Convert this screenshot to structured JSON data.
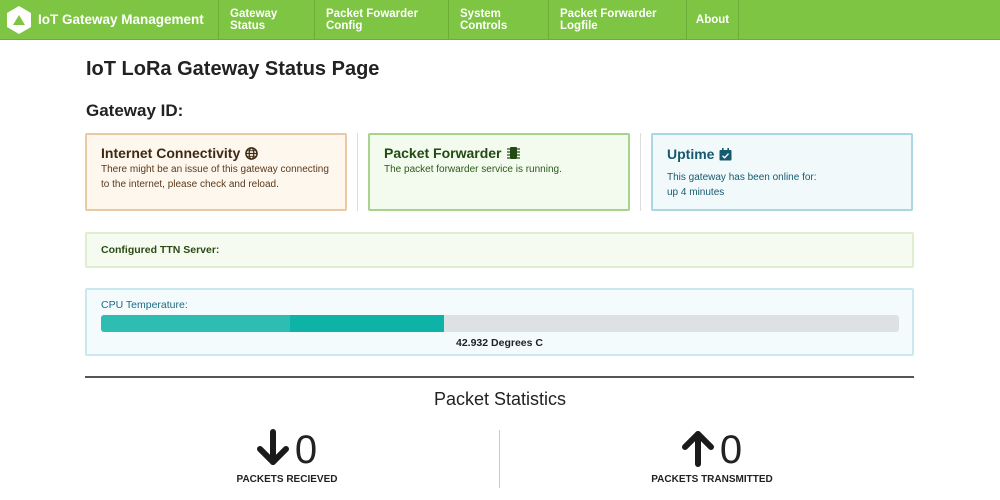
{
  "navbar": {
    "brand": "IoT Gateway Management",
    "items": [
      {
        "label": "Gateway Status"
      },
      {
        "label": "Packet Fowarder Config"
      },
      {
        "label": "System Controls"
      },
      {
        "label": "Packet Forwarder Logfile"
      },
      {
        "label": "About"
      }
    ]
  },
  "page": {
    "title": "IoT LoRa Gateway Status Page",
    "gateway_id_label": "Gateway ID:",
    "gateway_id_value": ""
  },
  "cards": {
    "internet": {
      "title": "Internet Connectivity",
      "icon": "globe-icon",
      "body": "There might be an issue of this gateway connecting to the internet, please check and reload."
    },
    "packet_forwarder": {
      "title": "Packet Forwarder",
      "icon": "chip-icon",
      "body": "The packet forwarder service is running."
    },
    "uptime": {
      "title": "Uptime",
      "icon": "calendar-check-icon",
      "body_line1": "This gateway has been online for:",
      "body_line2": "up 4 minutes"
    }
  },
  "ttn": {
    "label": "Configured TTN Server:",
    "value": ""
  },
  "cpu": {
    "label": "CPU Temperature:",
    "value_text": "42.932 Degrees C",
    "fill_fraction": 0.43
  },
  "stats": {
    "title": "Packet Statistics",
    "received": {
      "count": "0",
      "label": "PACKETS RECIEVED",
      "icon": "arrow-down-icon"
    },
    "transmitted": {
      "count": "0",
      "label": "PACKETS TRANSMITTED",
      "icon": "arrow-up-icon"
    }
  },
  "colors": {
    "navbar": "#7dc542",
    "progress": "#0cb3a6"
  }
}
